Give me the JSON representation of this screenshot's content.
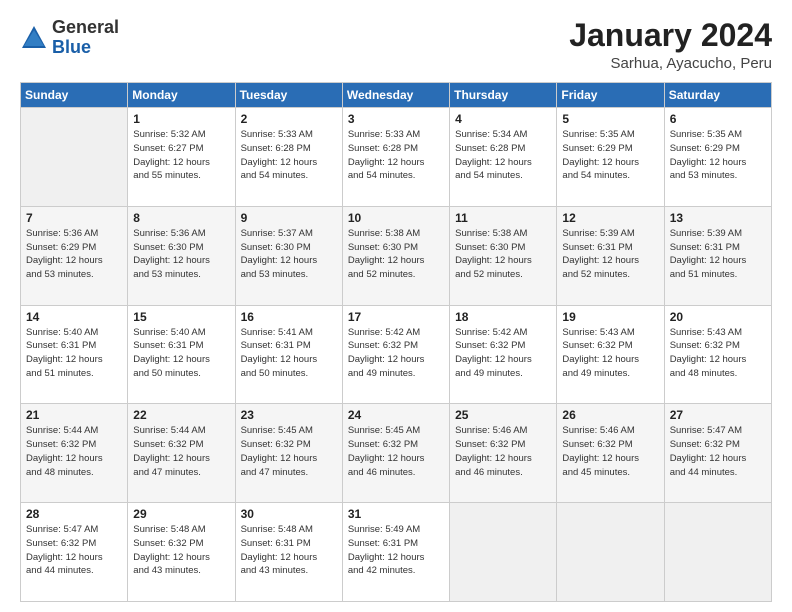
{
  "header": {
    "logo": {
      "general": "General",
      "blue": "Blue"
    },
    "title": "January 2024",
    "subtitle": "Sarhua, Ayacucho, Peru"
  },
  "columns": [
    "Sunday",
    "Monday",
    "Tuesday",
    "Wednesday",
    "Thursday",
    "Friday",
    "Saturday"
  ],
  "weeks": [
    [
      {
        "day": "",
        "info": ""
      },
      {
        "day": "1",
        "info": "Sunrise: 5:32 AM\nSunset: 6:27 PM\nDaylight: 12 hours\nand 55 minutes."
      },
      {
        "day": "2",
        "info": "Sunrise: 5:33 AM\nSunset: 6:28 PM\nDaylight: 12 hours\nand 54 minutes."
      },
      {
        "day": "3",
        "info": "Sunrise: 5:33 AM\nSunset: 6:28 PM\nDaylight: 12 hours\nand 54 minutes."
      },
      {
        "day": "4",
        "info": "Sunrise: 5:34 AM\nSunset: 6:28 PM\nDaylight: 12 hours\nand 54 minutes."
      },
      {
        "day": "5",
        "info": "Sunrise: 5:35 AM\nSunset: 6:29 PM\nDaylight: 12 hours\nand 54 minutes."
      },
      {
        "day": "6",
        "info": "Sunrise: 5:35 AM\nSunset: 6:29 PM\nDaylight: 12 hours\nand 53 minutes."
      }
    ],
    [
      {
        "day": "7",
        "info": "Sunrise: 5:36 AM\nSunset: 6:29 PM\nDaylight: 12 hours\nand 53 minutes."
      },
      {
        "day": "8",
        "info": "Sunrise: 5:36 AM\nSunset: 6:30 PM\nDaylight: 12 hours\nand 53 minutes."
      },
      {
        "day": "9",
        "info": "Sunrise: 5:37 AM\nSunset: 6:30 PM\nDaylight: 12 hours\nand 53 minutes."
      },
      {
        "day": "10",
        "info": "Sunrise: 5:38 AM\nSunset: 6:30 PM\nDaylight: 12 hours\nand 52 minutes."
      },
      {
        "day": "11",
        "info": "Sunrise: 5:38 AM\nSunset: 6:30 PM\nDaylight: 12 hours\nand 52 minutes."
      },
      {
        "day": "12",
        "info": "Sunrise: 5:39 AM\nSunset: 6:31 PM\nDaylight: 12 hours\nand 52 minutes."
      },
      {
        "day": "13",
        "info": "Sunrise: 5:39 AM\nSunset: 6:31 PM\nDaylight: 12 hours\nand 51 minutes."
      }
    ],
    [
      {
        "day": "14",
        "info": "Sunrise: 5:40 AM\nSunset: 6:31 PM\nDaylight: 12 hours\nand 51 minutes."
      },
      {
        "day": "15",
        "info": "Sunrise: 5:40 AM\nSunset: 6:31 PM\nDaylight: 12 hours\nand 50 minutes."
      },
      {
        "day": "16",
        "info": "Sunrise: 5:41 AM\nSunset: 6:31 PM\nDaylight: 12 hours\nand 50 minutes."
      },
      {
        "day": "17",
        "info": "Sunrise: 5:42 AM\nSunset: 6:32 PM\nDaylight: 12 hours\nand 49 minutes."
      },
      {
        "day": "18",
        "info": "Sunrise: 5:42 AM\nSunset: 6:32 PM\nDaylight: 12 hours\nand 49 minutes."
      },
      {
        "day": "19",
        "info": "Sunrise: 5:43 AM\nSunset: 6:32 PM\nDaylight: 12 hours\nand 49 minutes."
      },
      {
        "day": "20",
        "info": "Sunrise: 5:43 AM\nSunset: 6:32 PM\nDaylight: 12 hours\nand 48 minutes."
      }
    ],
    [
      {
        "day": "21",
        "info": "Sunrise: 5:44 AM\nSunset: 6:32 PM\nDaylight: 12 hours\nand 48 minutes."
      },
      {
        "day": "22",
        "info": "Sunrise: 5:44 AM\nSunset: 6:32 PM\nDaylight: 12 hours\nand 47 minutes."
      },
      {
        "day": "23",
        "info": "Sunrise: 5:45 AM\nSunset: 6:32 PM\nDaylight: 12 hours\nand 47 minutes."
      },
      {
        "day": "24",
        "info": "Sunrise: 5:45 AM\nSunset: 6:32 PM\nDaylight: 12 hours\nand 46 minutes."
      },
      {
        "day": "25",
        "info": "Sunrise: 5:46 AM\nSunset: 6:32 PM\nDaylight: 12 hours\nand 46 minutes."
      },
      {
        "day": "26",
        "info": "Sunrise: 5:46 AM\nSunset: 6:32 PM\nDaylight: 12 hours\nand 45 minutes."
      },
      {
        "day": "27",
        "info": "Sunrise: 5:47 AM\nSunset: 6:32 PM\nDaylight: 12 hours\nand 44 minutes."
      }
    ],
    [
      {
        "day": "28",
        "info": "Sunrise: 5:47 AM\nSunset: 6:32 PM\nDaylight: 12 hours\nand 44 minutes."
      },
      {
        "day": "29",
        "info": "Sunrise: 5:48 AM\nSunset: 6:32 PM\nDaylight: 12 hours\nand 43 minutes."
      },
      {
        "day": "30",
        "info": "Sunrise: 5:48 AM\nSunset: 6:31 PM\nDaylight: 12 hours\nand 43 minutes."
      },
      {
        "day": "31",
        "info": "Sunrise: 5:49 AM\nSunset: 6:31 PM\nDaylight: 12 hours\nand 42 minutes."
      },
      {
        "day": "",
        "info": ""
      },
      {
        "day": "",
        "info": ""
      },
      {
        "day": "",
        "info": ""
      }
    ]
  ]
}
